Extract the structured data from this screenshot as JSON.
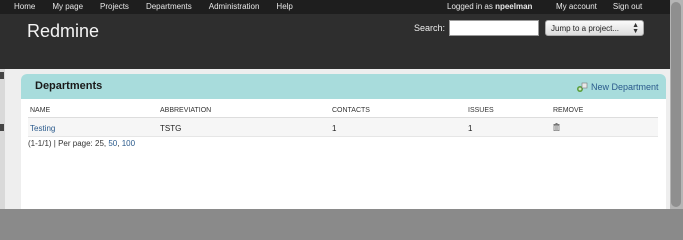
{
  "top_menu": {
    "left_items": [
      "Home",
      "My page",
      "Projects",
      "Departments",
      "Administration",
      "Help"
    ],
    "logged_in_prefix": "Logged in as",
    "username": "npeelman",
    "right_items": [
      "My account",
      "Sign out"
    ]
  },
  "header": {
    "title": "Redmine",
    "search_label": "Search:",
    "search_value": "",
    "project_jump_label": "Jump to a project..."
  },
  "panel": {
    "title": "Departments",
    "new_label": "New Department"
  },
  "table": {
    "headers": [
      "Name",
      "Abbreviation",
      "Contacts",
      "Issues",
      "Remove"
    ],
    "rows": [
      {
        "name": "Testing",
        "abbreviation": "TSTG",
        "contacts": "1",
        "issues": "1"
      }
    ]
  },
  "pagination": {
    "range": "(1-1/1) | Per page: 25,",
    "options": [
      "50",
      "100"
    ]
  },
  "colors": {
    "menu_bg": "#1e1e1e",
    "header_bg": "#2e2e2e",
    "panel_head": "#a8dcdc",
    "link": "#2a5a8c"
  }
}
